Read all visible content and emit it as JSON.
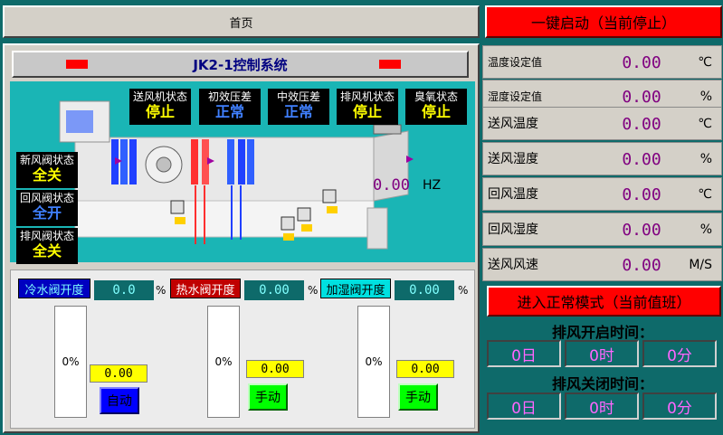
{
  "header": {
    "home_label": "首页",
    "start_label": "一键启动（当前停止）"
  },
  "title": "JK2-1控制系统",
  "status_top": [
    {
      "label": "送风机状态",
      "value": "停止"
    },
    {
      "label": "初效压差",
      "value": "正常"
    },
    {
      "label": "中效压差",
      "value": "正常"
    },
    {
      "label": "排风机状态",
      "value": "停止"
    },
    {
      "label": "臭氧状态",
      "value": "停止"
    }
  ],
  "status_left": [
    {
      "label": "新风阀状态",
      "value": "全关"
    },
    {
      "label": "回风阀状态",
      "value": "全开"
    },
    {
      "label": "排风阀状态",
      "value": "全关"
    }
  ],
  "frequency": {
    "value": "0.00",
    "unit": "HZ"
  },
  "readings": [
    {
      "label": "温度设定值",
      "value": "0.00",
      "unit": "℃"
    },
    {
      "label": "湿度设定值",
      "value": "0.00",
      "unit": "%"
    },
    {
      "label": "送风温度",
      "value": "0.00",
      "unit": "℃"
    },
    {
      "label": "送风湿度",
      "value": "0.00",
      "unit": "%"
    },
    {
      "label": "回风温度",
      "value": "0.00",
      "unit": "℃"
    },
    {
      "label": "回风湿度",
      "value": "0.00",
      "unit": "%"
    },
    {
      "label": "送风风速",
      "value": "0.00",
      "unit": "M/S"
    }
  ],
  "valves": [
    {
      "label": "冷水阀开度",
      "value": "0.0",
      "unit": "%",
      "bar_text": "0%",
      "set_value": "0.00",
      "mode": "自动",
      "level": 0
    },
    {
      "label": "热水阀开度",
      "value": "0.00",
      "unit": "%",
      "bar_text": "0%",
      "set_value": "0.00",
      "mode": "手动",
      "level": 0
    },
    {
      "label": "加湿阀开度",
      "value": "0.00",
      "unit": "%",
      "bar_text": "0%",
      "set_value": "0.00",
      "mode": "手动",
      "level": 0
    }
  ],
  "mode_button": "进入正常模式（当前值班）",
  "exhaust_on": {
    "title": "排风开启时间：",
    "day": "0日",
    "hour": "0时",
    "min": "0分"
  },
  "exhaust_off": {
    "title": "排风关闭时间：",
    "day": "0日",
    "hour": "0时",
    "min": "0分"
  },
  "colors": {
    "accent_red": "#ff0000",
    "panel_teal": "#0e6a6a",
    "diagram_cyan": "#1ab5b5",
    "status_yellow": "#ffff00"
  }
}
